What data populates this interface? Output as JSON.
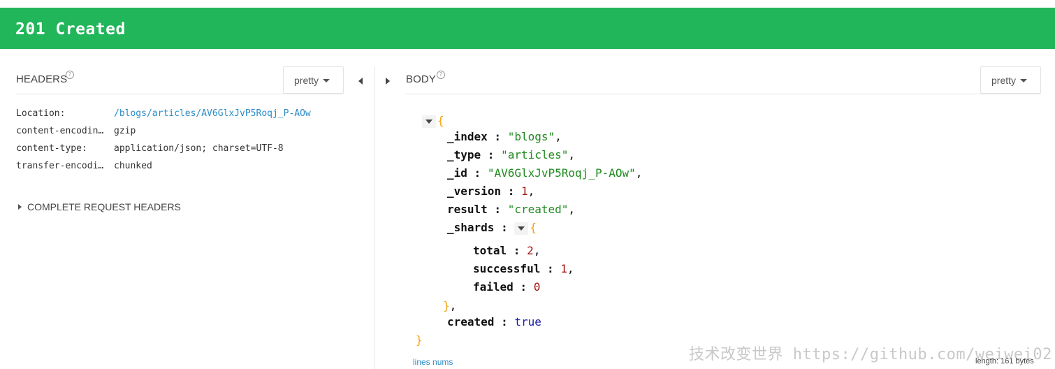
{
  "status": {
    "text": "201 Created",
    "color": "#21b65a"
  },
  "headers_panel": {
    "title": "HEADERS",
    "help_glyph": "?",
    "format_label": "pretty",
    "rows": [
      {
        "key": "Location:",
        "value": "/blogs/articles/AV6GlxJvP5Roqj_P-AOw"
      },
      {
        "key": "content-encodin…",
        "value": "gzip"
      },
      {
        "key": "content-type:",
        "value": "application/json; charset=UTF-8"
      },
      {
        "key": "transfer-encodi…",
        "value": "chunked"
      }
    ],
    "complete_request_label": "COMPLETE REQUEST HEADERS"
  },
  "body_panel": {
    "title": "BODY",
    "help_glyph": "?",
    "format_label": "pretty",
    "json": {
      "open": "{",
      "index_key": "_index",
      "index_val": "\"blogs\"",
      "type_key": "_type",
      "type_val": "\"articles\"",
      "id_key": "_id",
      "id_val": "\"AV6GlxJvP5Roqj_P-AOw\"",
      "version_key": "_version",
      "version_val": "1",
      "result_key": "result",
      "result_val": "\"created\"",
      "shards_key": "_shards",
      "shards_open": "{",
      "total_key": "total",
      "total_val": "2",
      "successful_key": "successful",
      "successful_val": "1",
      "failed_key": "failed",
      "failed_val": "0",
      "shards_close": "}",
      "created_key": "created",
      "created_val": "true",
      "close": "}"
    },
    "lines_nums_label": "lines nums",
    "length_label": "length: 161 bytes"
  },
  "watermark": "技术改变世界 https://github.com/weiwei02",
  "icons": {
    "collapse_left": "caret-left-icon",
    "expand_right": "caret-right-icon",
    "dropdown": "caret-down-icon"
  }
}
